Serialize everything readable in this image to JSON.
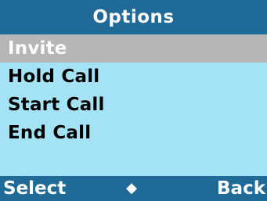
{
  "header": {
    "title": "Options"
  },
  "menu": {
    "items": [
      {
        "label": "Invite",
        "selected": true
      },
      {
        "label": "Hold Call",
        "selected": false
      },
      {
        "label": "Start Call",
        "selected": false
      },
      {
        "label": "End Call",
        "selected": false
      }
    ]
  },
  "softkeys": {
    "left_label": "Select",
    "center_icon": "up-down-arrows-icon",
    "center_glyph": "◆",
    "right_label": "Back"
  },
  "colors": {
    "bar": "#1f6a96",
    "background": "#a3e3f5",
    "selection": "#b6b6b6",
    "text": "#000000",
    "bar_text": "#ffffff"
  }
}
